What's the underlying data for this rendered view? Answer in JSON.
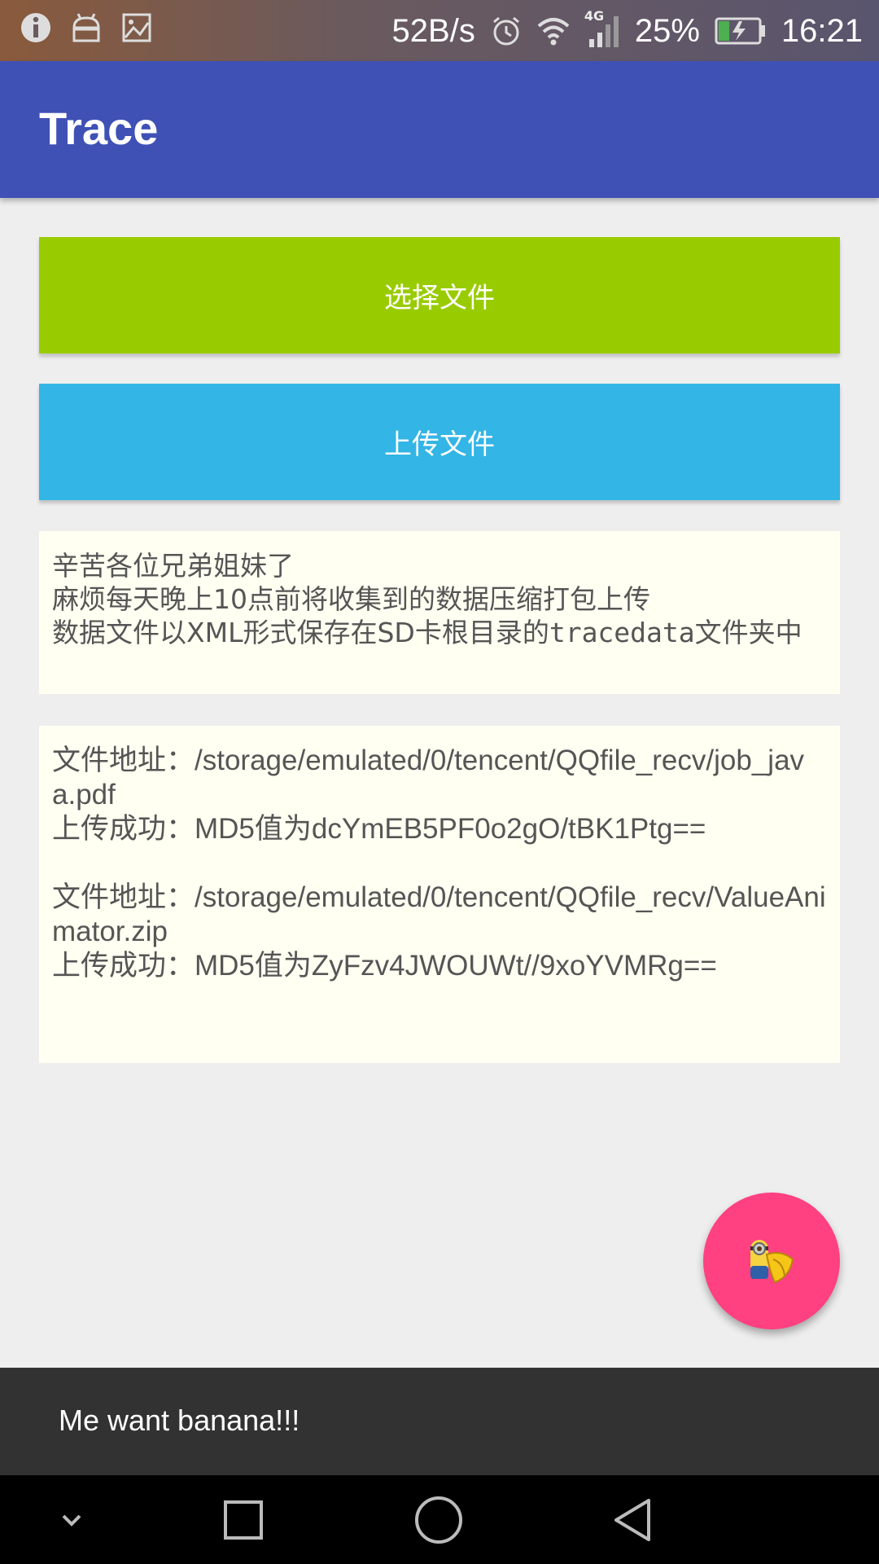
{
  "status_bar": {
    "net_speed": "52B/s",
    "network_type": "4G",
    "battery_percent": "25%",
    "time": "16:21",
    "icons": [
      "info-icon",
      "android-icon",
      "image-icon",
      "alarm-icon",
      "wifi-icon",
      "signal-icon",
      "battery-charging-icon"
    ]
  },
  "app_bar": {
    "title": "Trace"
  },
  "buttons": {
    "select_file": "选择文件",
    "upload_file": "上传文件"
  },
  "notice": {
    "line1": "辛苦各位兄弟姐妹了",
    "line2": "麻烦每天晚上10点前将收集到的数据压缩打包上传",
    "line3_prefix": "数据文件以XML形式保存在SD卡根目录的",
    "line3_mono": "tracedata",
    "line3_suffix": "文件夹中"
  },
  "log": [
    {
      "path_label": "文件地址：/storage/emulated/0/tencent/QQfile_recv/job_java.pdf",
      "result": "上传成功：MD5值为dcYmEB5PF0o2gO/tBK1Ptg=="
    },
    {
      "path_label": "文件地址：/storage/emulated/0/tencent/QQfile_recv/ValueAnimator.zip",
      "result": "上传成功：MD5值为ZyFzv4JWOUWt//9xoYVMRg=="
    }
  ],
  "fab": {
    "icon": "minion-banana-icon"
  },
  "snackbar": {
    "message": "Me want banana!!!"
  },
  "nav_bar": {
    "icons": [
      "chevron-down-icon",
      "recents-icon",
      "home-icon",
      "back-icon"
    ]
  },
  "colors": {
    "app_bar": "#3f51b5",
    "select_button": "#99cc00",
    "upload_button": "#33b5e5",
    "fab": "#ff4081",
    "snackbar": "#323232"
  }
}
